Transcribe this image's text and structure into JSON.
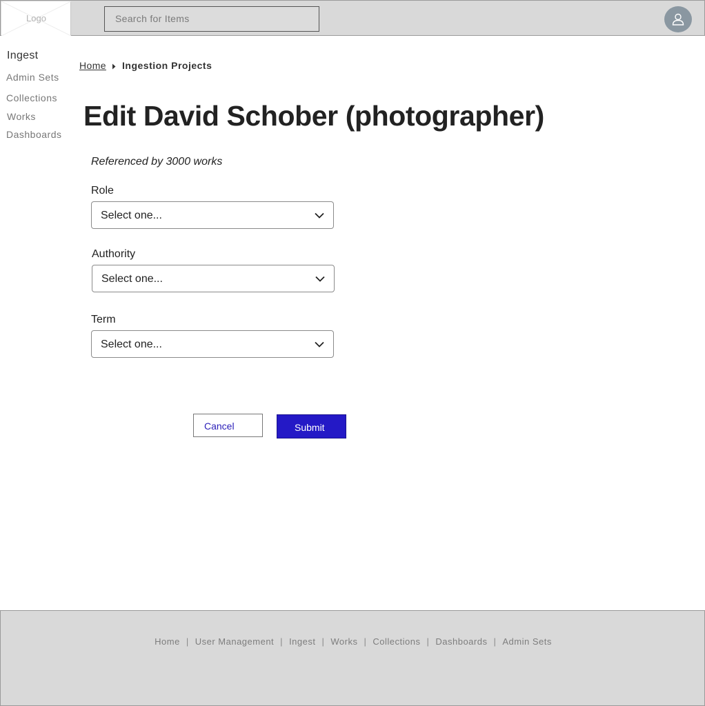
{
  "header": {
    "logo_text": "Logo",
    "search_placeholder": "Search for Items",
    "avatar_icon": "user-icon"
  },
  "sidebar": {
    "title": "Ingest",
    "items": [
      {
        "label": "Admin Sets"
      },
      {
        "label": "Collections"
      },
      {
        "label": "Works"
      },
      {
        "label": "Dashboards"
      }
    ]
  },
  "breadcrumb": {
    "home": "Home",
    "current": "Ingestion Projects"
  },
  "page": {
    "title": "Edit David Schober (photographer)",
    "subtitle": "Referenced by 3000 works"
  },
  "form": {
    "fields": [
      {
        "label": "Role",
        "value": "Select one..."
      },
      {
        "label": "Authority",
        "value": "Select one..."
      },
      {
        "label": "Term",
        "value": "Select one..."
      }
    ],
    "cancel_label": "Cancel",
    "submit_label": "Submit"
  },
  "footer": {
    "links": [
      "Home",
      "User Management",
      "Ingest",
      "Works",
      "Collections",
      "Dashboards",
      "Admin Sets"
    ],
    "separator": "|"
  },
  "colors": {
    "header_bg": "#d9d9d9",
    "submit_bg": "#2419c6",
    "cancel_text": "#2a1eb8",
    "avatar_bg": "#8a97a1"
  }
}
